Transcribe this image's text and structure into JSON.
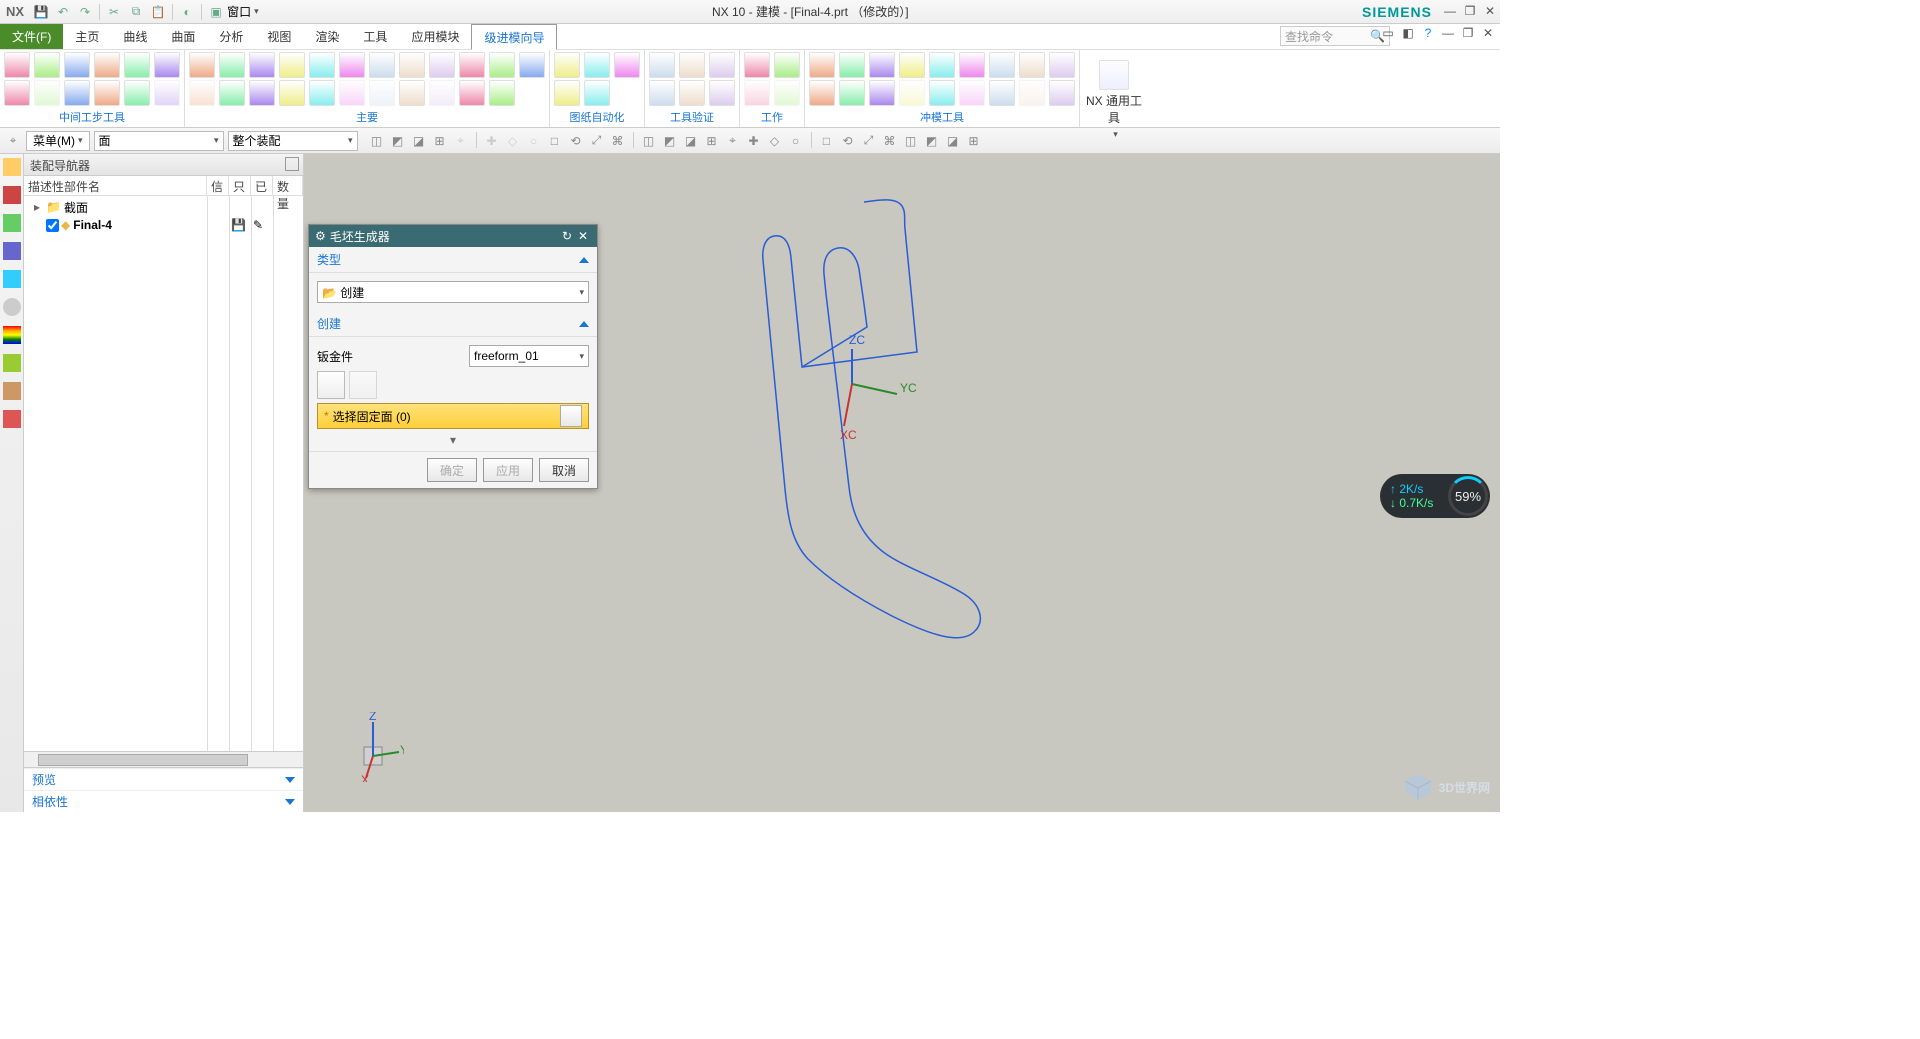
{
  "title": "NX 10 - 建模 - [Final-4.prt （修改的）]",
  "brand": "SIEMENS",
  "qat": {
    "window_label": "窗口"
  },
  "menubar": {
    "file": "文件(F)",
    "tabs": [
      "主页",
      "曲线",
      "曲面",
      "分析",
      "视图",
      "渲染",
      "工具",
      "应用模块",
      "级进模向导"
    ],
    "active_index": 8,
    "search_placeholder": "查找命令"
  },
  "ribbon_groups": [
    {
      "name": "中间工步工具",
      "rows": [
        6,
        6
      ]
    },
    {
      "name": "主要",
      "rows": [
        12,
        11
      ]
    },
    {
      "name": "图纸自动化",
      "rows": [
        3,
        2
      ]
    },
    {
      "name": "工具验证",
      "rows": [
        3,
        3
      ]
    },
    {
      "name": "工作",
      "rows": [
        2,
        2
      ]
    },
    {
      "name": "冲模工具",
      "rows": [
        9,
        9
      ]
    }
  ],
  "ribbon_big_button": "NX 通用工具",
  "selbar": {
    "menu_btn": "菜单(M)",
    "filter1": "面",
    "filter2": "整个装配"
  },
  "navigator": {
    "title": "装配导航器",
    "col0": "描述性部件名",
    "cols": [
      "信",
      "只",
      "已",
      "数量"
    ],
    "node_folder": "截面",
    "node_part": "Final-4"
  },
  "panel_footer": {
    "preview": "预览",
    "deps": "相依性"
  },
  "dialog": {
    "title": "毛坯生成器",
    "sec_type": "类型",
    "type_value": "创建",
    "sec_create": "创建",
    "sheet_label": "钣金件",
    "sheet_value": "freeform_01",
    "select_text": "选择固定面 (0)",
    "ok": "确定",
    "apply": "应用",
    "cancel": "取消"
  },
  "axes": {
    "x": "XC",
    "y": "YC",
    "z": "ZC"
  },
  "netmon": {
    "up": "2K/s",
    "down": "0.7K/s",
    "pct": "59%"
  },
  "watermark": "3D世界网"
}
